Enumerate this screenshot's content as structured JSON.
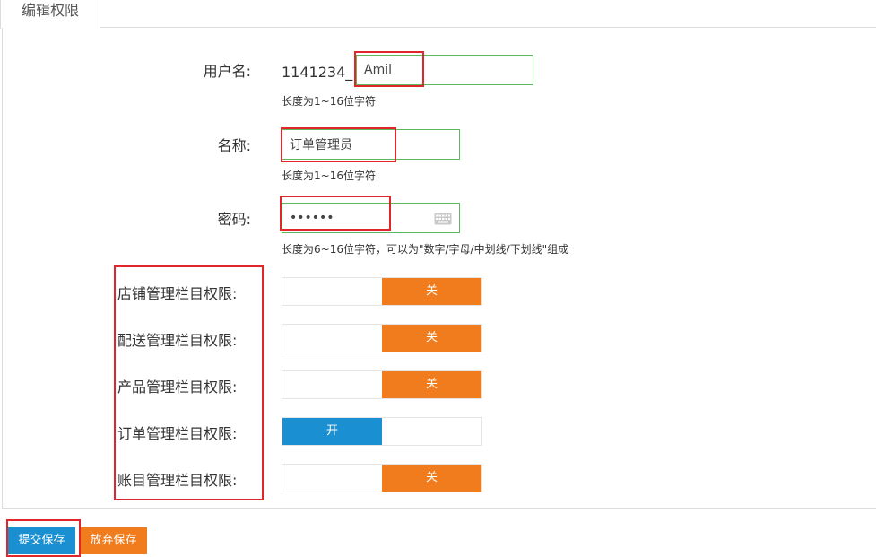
{
  "tab": {
    "label": "编辑权限"
  },
  "form": {
    "username": {
      "label": "用户名:",
      "prefix": "1141234_",
      "value": "Amil",
      "hint": "长度为1~16位字符"
    },
    "name": {
      "label": "名称:",
      "value": "订单管理员",
      "hint": "长度为1~16位字符"
    },
    "password": {
      "label": "密码:",
      "value": "••••••",
      "hint": "长度为6~16位字符，可以为\"数字/字母/中划线/下划线\"组成",
      "icon": "keyboard-icon"
    },
    "permissions": [
      {
        "label": "店铺管理栏目权限:",
        "state": "关",
        "on": false
      },
      {
        "label": "配送管理栏目权限:",
        "state": "关",
        "on": false
      },
      {
        "label": "产品管理栏目权限:",
        "state": "关",
        "on": false
      },
      {
        "label": "订单管理栏目权限:",
        "state": "开",
        "on": true
      },
      {
        "label": "账目管理栏目权限:",
        "state": "关",
        "on": false
      }
    ]
  },
  "actions": {
    "submit": "提交保存",
    "discard": "放弃保存"
  },
  "colors": {
    "on": "#1a8fd2",
    "off": "#f07c1e",
    "highlight": "#e0262b",
    "input_border": "#5bb85d"
  }
}
